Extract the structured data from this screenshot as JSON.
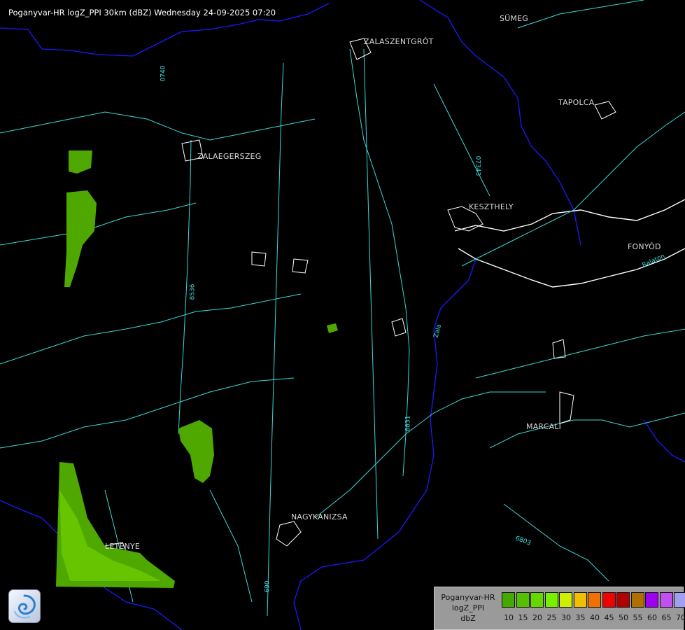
{
  "header": {
    "title": "Poganyvar-HR logZ_PPI 30km (dBZ) Wednesday 24-09-2025 07:20"
  },
  "cities": [
    {
      "name": "SÜMEG"
    },
    {
      "name": "ZALASZENTGRÓT"
    },
    {
      "name": "TAPOLCA"
    },
    {
      "name": "ZALAEGERSZEG"
    },
    {
      "name": "KESZTHELY"
    },
    {
      "name": "FONYÓD"
    },
    {
      "name": "MARCALI"
    },
    {
      "name": "NAGYKANIZSA"
    },
    {
      "name": "LETENYE"
    }
  ],
  "roads": [
    {
      "name": "0740"
    },
    {
      "name": "07343"
    },
    {
      "name": "8536"
    },
    {
      "name": "6831"
    },
    {
      "name": "6803"
    },
    {
      "name": "690"
    }
  ],
  "rivers": [
    {
      "name": "Zala"
    },
    {
      "name": "Balaton"
    }
  ],
  "legend": {
    "label_lines": [
      "Poganyvar-HR",
      "logZ_PPI",
      "dbZ"
    ],
    "ticks": [
      "10",
      "15",
      "20",
      "25",
      "30",
      "35",
      "40",
      "45",
      "50",
      "55",
      "60",
      "65",
      "70"
    ],
    "colors": [
      "#44aa00",
      "#55c000",
      "#66d800",
      "#77f000",
      "#ccf000",
      "#f0c000",
      "#f07000",
      "#f00000",
      "#b00000",
      "#b07000",
      "#a000f0",
      "#c050f0",
      "#a0a0f0"
    ]
  },
  "echo_colors": {
    "weak": "#4fa800",
    "medium": "#66c400"
  }
}
